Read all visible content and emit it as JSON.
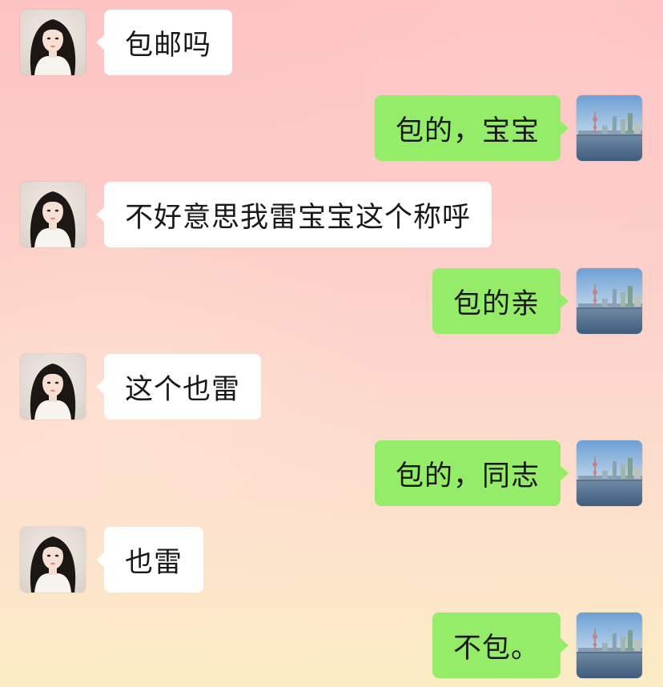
{
  "chat": {
    "messages": [
      {
        "sender": "contact",
        "text": "包邮吗"
      },
      {
        "sender": "me",
        "text": "包的，宝宝"
      },
      {
        "sender": "contact",
        "text": "不好意思我雷宝宝这个称呼"
      },
      {
        "sender": "me",
        "text": "包的亲"
      },
      {
        "sender": "contact",
        "text": "这个也雷"
      },
      {
        "sender": "me",
        "text": "包的，同志"
      },
      {
        "sender": "contact",
        "text": "也雷"
      },
      {
        "sender": "me",
        "text": "不包。"
      }
    ]
  },
  "avatars": {
    "contact": "woman-portrait-photo",
    "me": "city-skyline-photo"
  },
  "colors": {
    "incoming_bubble": "#ffffff",
    "outgoing_bubble": "#95ec69",
    "text": "#191919"
  }
}
